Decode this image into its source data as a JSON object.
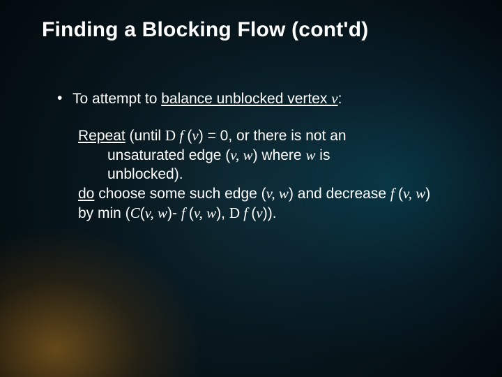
{
  "slide": {
    "title": "Finding a Blocking Flow (cont'd)",
    "bullet": {
      "dot": "•",
      "pre": "To attempt to ",
      "underlined": "balance unblocked vertex ",
      "v": "v",
      "post": ":"
    },
    "repeat": {
      "word": "Repeat",
      "l1a": " (until ",
      "d1": "D",
      "f1": " f ",
      "l1b": "(",
      "v1": "v",
      "l1c": ") = 0, or there is not an",
      "l2a": "unsaturated edge (",
      "v2": "v, w",
      "l2b": ") where ",
      "w": "w",
      "l2c": " is",
      "l3": "unblocked)."
    },
    "do": {
      "word": "do",
      "l1a": " choose some such edge (",
      "vw1": "v, w",
      "l1b": ") and  decrease ",
      "f": "f ",
      "l1c": "(",
      "vw2": "v, w",
      "l1d": ")",
      "l2a": "by min (",
      "C": "C",
      "l2b": "(",
      "vw3": "v, w",
      "l2c": ")- ",
      "f2": "f ",
      "l2d": "(",
      "vw4": "v, w",
      "l2e": "), ",
      "d2": "D",
      "f3": " f ",
      "l2f": "(",
      "v3": "v",
      "l2g": "))."
    }
  }
}
